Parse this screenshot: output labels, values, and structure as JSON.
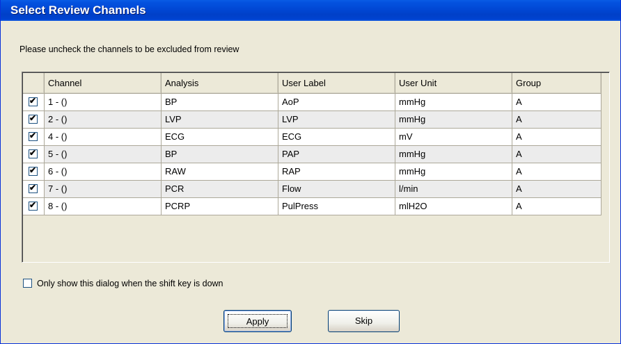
{
  "window": {
    "title": "Select Review Channels"
  },
  "instruction": "Please uncheck the channels to be excluded from review",
  "table": {
    "columns": [
      "",
      "Channel",
      "Analysis",
      "User Label",
      "User Unit",
      "Group"
    ],
    "rows": [
      {
        "checked": true,
        "channel": "1 - ()",
        "analysis": "BP",
        "user_label": "AoP",
        "user_unit": "mmHg",
        "group": "A"
      },
      {
        "checked": true,
        "channel": "2 - ()",
        "analysis": "LVP",
        "user_label": "LVP",
        "user_unit": "mmHg",
        "group": "A"
      },
      {
        "checked": true,
        "channel": "4 - ()",
        "analysis": "ECG",
        "user_label": "ECG",
        "user_unit": "mV",
        "group": "A"
      },
      {
        "checked": true,
        "channel": "5 - ()",
        "analysis": "BP",
        "user_label": "PAP",
        "user_unit": "mmHg",
        "group": "A"
      },
      {
        "checked": true,
        "channel": "6 - ()",
        "analysis": "RAW",
        "user_label": "RAP",
        "user_unit": "mmHg",
        "group": "A"
      },
      {
        "checked": true,
        "channel": "7 - ()",
        "analysis": "PCR",
        "user_label": "Flow",
        "user_unit": "l/min",
        "group": "A"
      },
      {
        "checked": true,
        "channel": "8 - ()",
        "analysis": "PCRP",
        "user_label": "PulPress",
        "user_unit": "mlH2O",
        "group": "A"
      }
    ]
  },
  "option": {
    "label": "Only show this dialog when the shift key is down",
    "checked": false
  },
  "buttons": {
    "apply": "Apply",
    "skip": "Skip"
  },
  "colors": {
    "titlebar": "#0149d6",
    "dialog_bg": "#ECE9D8",
    "alt_row": "#ececec"
  }
}
